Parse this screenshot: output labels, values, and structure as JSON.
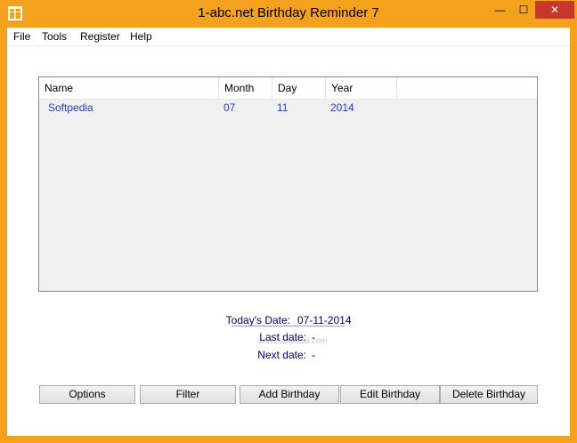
{
  "window": {
    "title": "1-abc.net Birthday Reminder 7",
    "accent_color": "#f4a11e",
    "controls": {
      "minimize": "—",
      "maximize": "☐",
      "close": "✕"
    }
  },
  "menu": {
    "items": [
      "File",
      "Tools",
      "Register",
      "Help"
    ]
  },
  "list": {
    "columns": [
      "Name",
      "Month",
      "Day",
      "Year"
    ],
    "rows": [
      {
        "name": "Softpedia",
        "month": "07",
        "day": "11",
        "year": "2014"
      }
    ]
  },
  "info": {
    "today_label": "Today's Date:",
    "today_value": "07-11-2014",
    "last_label": "Last date:",
    "last_value": "-",
    "next_label": "Next date:",
    "next_value": "-",
    "watermark": "www.softpedia.com"
  },
  "buttons": {
    "options": "Options",
    "filter": "Filter",
    "add": "Add Birthday",
    "edit": "Edit Birthday",
    "delete": "Delete Birthday"
  }
}
